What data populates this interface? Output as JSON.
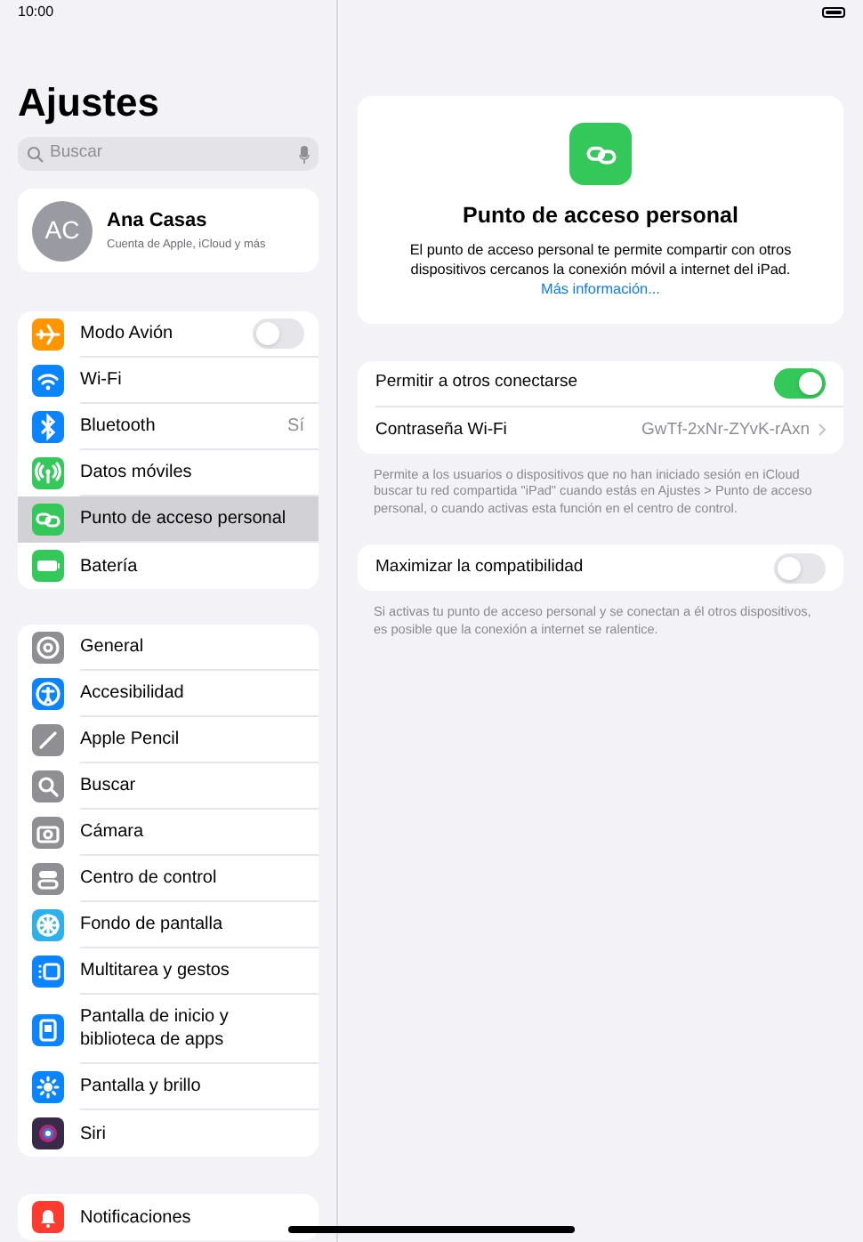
{
  "status_bar": {
    "time": "10:00"
  },
  "sidebar": {
    "title": "Ajustes",
    "search": {
      "placeholder": "Buscar"
    },
    "profile": {
      "initials": "AC",
      "name": "Ana Casas",
      "subtitle": "Cuenta de Apple, iCloud y más"
    },
    "groups": [
      {
        "items": [
          {
            "label": "Modo Avión",
            "color": "#ff9500",
            "kind": "toggle",
            "on": false,
            "selected": false
          },
          {
            "label": "Wi-Fi",
            "color": "#0a84ff",
            "kind": "link",
            "selected": false
          },
          {
            "label": "Bluetooth",
            "color": "#0a84ff",
            "kind": "value",
            "value": "Sí",
            "selected": false
          },
          {
            "label": "Datos móviles",
            "color": "#34c759",
            "kind": "link",
            "selected": false
          },
          {
            "label": "Punto de acceso personal",
            "color": "#34c759",
            "kind": "link",
            "selected": true
          },
          {
            "label": "Batería",
            "color": "#34c759",
            "kind": "link",
            "selected": false
          }
        ]
      },
      {
        "items": [
          {
            "label": "General",
            "color": "#8e8e93",
            "kind": "link",
            "selected": false
          },
          {
            "label": "Accesibilidad",
            "color": "#0a84ff",
            "kind": "link",
            "selected": false
          },
          {
            "label": "Apple Pencil",
            "color": "#8e8e93",
            "kind": "link",
            "selected": false
          },
          {
            "label": "Buscar",
            "color": "#8e8e93",
            "kind": "link",
            "selected": false
          },
          {
            "label": "Cámara",
            "color": "#8e8e93",
            "kind": "link",
            "selected": false
          },
          {
            "label": "Centro de control",
            "color": "#8e8e93",
            "kind": "link",
            "selected": false
          },
          {
            "label": "Fondo de pantalla",
            "color": "#30b0e8",
            "kind": "link",
            "selected": false
          },
          {
            "label": "Multitarea y gestos",
            "color": "#0a84ff",
            "kind": "link",
            "selected": false
          },
          {
            "label": "Pantalla de inicio y biblioteca de apps",
            "color": "#0a84ff",
            "kind": "link",
            "selected": false
          },
          {
            "label": "Pantalla y brillo",
            "color": "#0a84ff",
            "kind": "link",
            "selected": false
          },
          {
            "label": "Siri",
            "color": "#3a2a4a",
            "kind": "link",
            "selected": false
          }
        ]
      },
      {
        "items": [
          {
            "label": "Notificaciones",
            "color": "#ff3b30",
            "kind": "link",
            "selected": false
          }
        ]
      }
    ]
  },
  "detail": {
    "header": {
      "title": "Punto de acceso personal",
      "description": "El punto de acceso personal te permite compartir con otros dispositivos cercanos la conexión móvil a internet del iPad.",
      "link": "Más información..."
    },
    "sections": [
      {
        "rows": [
          {
            "label": "Permitir a otros conectarse",
            "kind": "toggle",
            "on": true
          },
          {
            "label": "Contraseña Wi-Fi",
            "kind": "value",
            "value": "GwTf-2xNr-ZYvK-rAxn"
          }
        ],
        "footer": "Permite a los usuarios o dispositivos que no han iniciado sesión en iCloud buscar tu red compartida \"iPad\" cuando estás en Ajustes > Punto de acceso personal, o cuando activas esta función en el centro de control."
      },
      {
        "rows": [
          {
            "label": "Maximizar la compatibilidad",
            "kind": "toggle",
            "on": false
          }
        ],
        "footer": "Si activas tu punto de acceso personal y se conectan a él otros dispositivos, es posible que la conexión a internet se ralentice."
      }
    ]
  }
}
